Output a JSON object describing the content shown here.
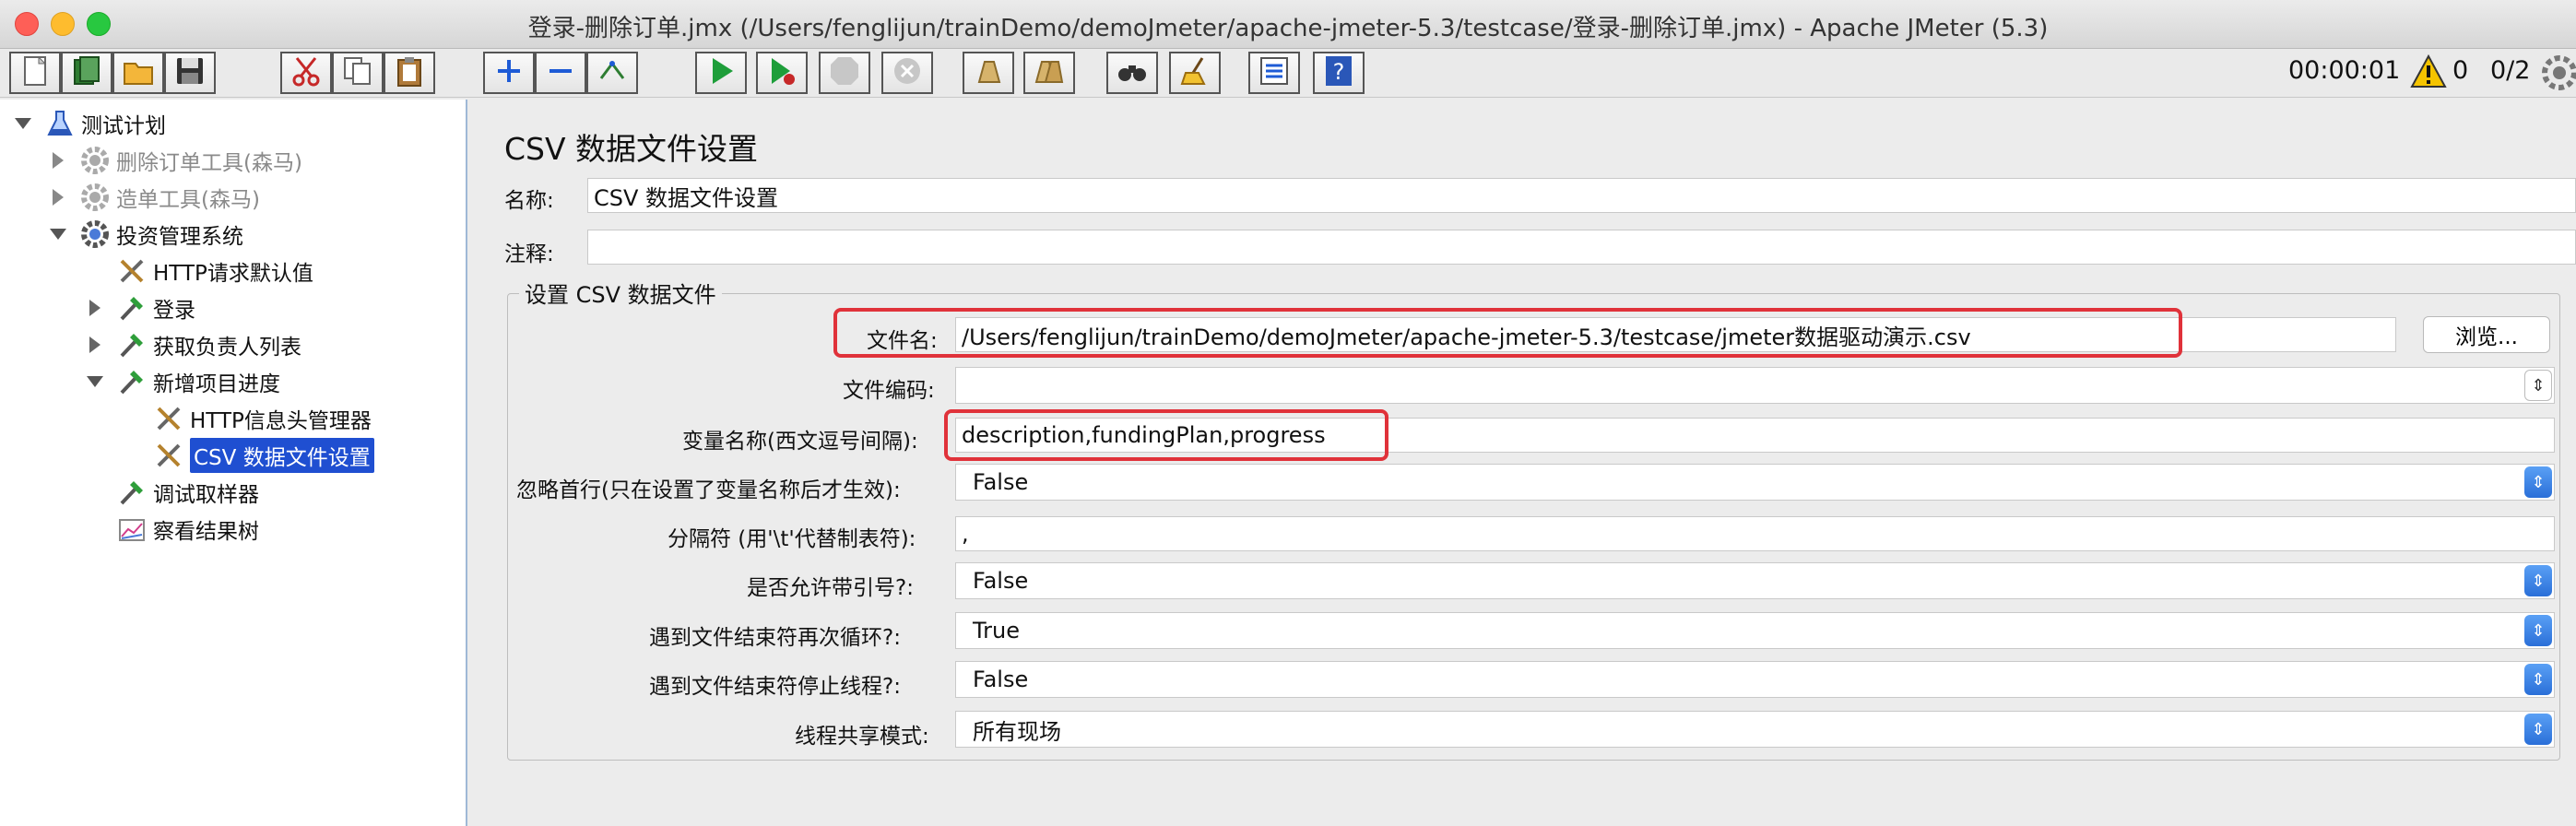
{
  "window": {
    "title": "登录-删除订单.jmx (/Users/fenglijun/trainDemo/demoJmeter/apache-jmeter-5.3/testcase/登录-删除订单.jmx) - Apache JMeter (5.3)",
    "traffic_colors": {
      "close": "#fe5f57",
      "minimize": "#febc2e",
      "zoom": "#28c840"
    }
  },
  "toolbar": {
    "icons": [
      "new-icon",
      "templates-icon",
      "open-icon",
      "save-icon",
      "cut-icon",
      "copy-icon",
      "paste-icon",
      "expand-icon",
      "collapse-icon",
      "toggle-icon",
      "start-icon",
      "start-no-pause-icon",
      "stop-icon",
      "shutdown-icon",
      "clear-icon",
      "clear-all-icon",
      "search-icon",
      "reset-search-icon",
      "function-helper-icon",
      "help-icon"
    ],
    "timer": "00:00:01",
    "warning_count": "0",
    "threads": "0/2"
  },
  "tree": {
    "nodes": [
      {
        "label": "测试计划",
        "depth": 0,
        "expanded": true,
        "icon": "flask-icon",
        "disabled": false
      },
      {
        "label": "删除订单工具(森马)",
        "depth": 1,
        "expanded": false,
        "icon": "gear-icon",
        "disabled": true
      },
      {
        "label": "造单工具(森马)",
        "depth": 1,
        "expanded": false,
        "icon": "gear-icon",
        "disabled": true
      },
      {
        "label": "投资管理系统",
        "depth": 1,
        "expanded": true,
        "icon": "gear-icon",
        "disabled": false
      },
      {
        "label": "HTTP请求默认值",
        "depth": 2,
        "icon": "wrench-icon",
        "disabled": false
      },
      {
        "label": "登录",
        "depth": 2,
        "expanded": false,
        "icon": "sampler-icon",
        "disabled": false
      },
      {
        "label": "获取负责人列表",
        "depth": 2,
        "expanded": false,
        "icon": "sampler-icon",
        "disabled": false
      },
      {
        "label": "新增项目进度",
        "depth": 2,
        "expanded": true,
        "icon": "sampler-icon",
        "disabled": false
      },
      {
        "label": "HTTP信息头管理器",
        "depth": 3,
        "icon": "wrench-icon",
        "disabled": false
      },
      {
        "label": "CSV 数据文件设置",
        "depth": 3,
        "icon": "wrench-icon",
        "disabled": false,
        "selected": true
      },
      {
        "label": "调试取样器",
        "depth": 2,
        "icon": "sampler-icon",
        "disabled": false
      },
      {
        "label": "察看结果树",
        "depth": 2,
        "icon": "chart-icon",
        "disabled": false
      }
    ]
  },
  "panel": {
    "heading": "CSV 数据文件设置",
    "name_label": "名称:",
    "name_value": "CSV 数据文件设置",
    "comment_label": "注释:",
    "comment_value": "",
    "group_title": "设置 CSV 数据文件",
    "filename_label": "文件名:",
    "filename_value": "/Users/fenglijun/trainDemo/demoJmeter/apache-jmeter-5.3/testcase/jmeter数据驱动演示.csv",
    "browse_label": "浏览...",
    "encoding_label": "文件编码:",
    "encoding_value": "",
    "varnames_label": "变量名称(西文逗号间隔):",
    "varnames_value": "description,fundingPlan,progress",
    "ignore_first_label": "忽略首行(只在设置了变量名称后才生效):",
    "ignore_first_value": "False",
    "delimiter_label": "分隔符 (用'\\t'代替制表符):",
    "delimiter_value": ",",
    "quoted_label": "是否允许带引号?:",
    "quoted_value": "False",
    "recycle_label": "遇到文件结束符再次循环?:",
    "recycle_value": "True",
    "stop_thread_label": "遇到文件结束符停止线程?:",
    "stop_thread_value": "False",
    "sharing_label": "线程共享模式:",
    "sharing_value": "所有现场",
    "highlight_color": "#e0323a",
    "selection_color": "#1f4fd1"
  }
}
